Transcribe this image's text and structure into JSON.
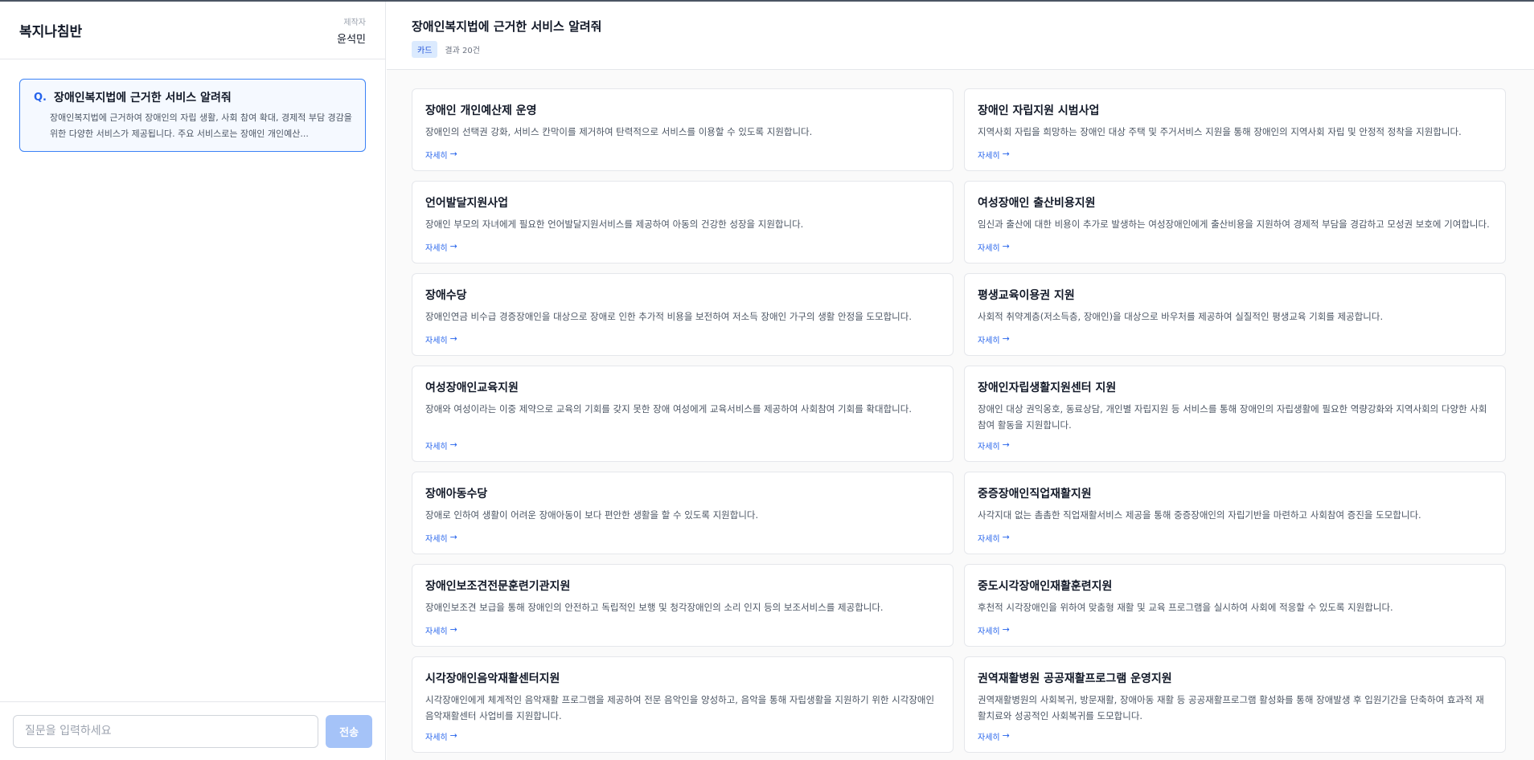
{
  "sidebar": {
    "app_title": "복지나침반",
    "maker_label": "제작자",
    "maker_name": "윤석민",
    "question": {
      "mark": "Q.",
      "title": "장애인복지법에 근거한 서비스 알려줘",
      "answer": "장애인복지법에 근거하여 장애인의 자립 생활, 사회 참여 확대, 경제적 부담 경감을 위한 다양한 서비스가 제공됩니다. 주요 서비스로는 장애인 개인예산..."
    },
    "input_placeholder": "질문을 입력하세요",
    "send_label": "전송"
  },
  "main": {
    "title": "장애인복지법에 근거한 서비스 알려줘",
    "view_badge": "카드",
    "result_count": "결과 20건",
    "link_label": "자세히",
    "link_arrow": "→",
    "cards": [
      {
        "title": "장애인 개인예산제 운영",
        "desc": "장애인의 선택권 강화, 서비스 칸막이를 제거하여 탄력적으로 서비스를 이용할 수 있도록 지원합니다."
      },
      {
        "title": "장애인 자립지원 시범사업",
        "desc": "지역사회 자립을 희망하는 장애인 대상 주택 및 주거서비스 지원을 통해 장애인의 지역사회 자립 및 안정적 정착을 지원합니다."
      },
      {
        "title": "언어발달지원사업",
        "desc": "장애인 부모의 자녀에게 필요한 언어발달지원서비스를 제공하여 아동의 건강한 성장을 지원합니다."
      },
      {
        "title": "여성장애인 출산비용지원",
        "desc": "임신과 출산에 대한 비용이 추가로 발생하는 여성장애인에게 출산비용을 지원하여 경제적 부담을 경감하고 모성권 보호에 기여합니다."
      },
      {
        "title": "장애수당",
        "desc": "장애인연금 비수급 경증장애인을 대상으로 장애로 인한 추가적 비용을 보전하여 저소득 장애인 가구의 생활 안정을 도모합니다."
      },
      {
        "title": "평생교육이용권 지원",
        "desc": "사회적 취약계층(저소득층, 장애인)을 대상으로 바우처를 제공하여 실질적인 평생교육 기회를 제공합니다."
      },
      {
        "title": "여성장애인교육지원",
        "desc": "장애와 여성이라는 이중 제약으로 교육의 기회를 갖지 못한 장애 여성에게 교육서비스를 제공하여 사회참여 기회를 확대합니다."
      },
      {
        "title": "장애인자립생활지원센터 지원",
        "desc": "장애인 대상 권익옹호, 동료상담, 개인별 자립지원 등 서비스를 통해 장애인의 자립생활에 필요한 역량강화와 지역사회의 다양한 사회참여 활동을 지원합니다."
      },
      {
        "title": "장애아동수당",
        "desc": "장애로 인하여 생활이 어려운 장애아동이 보다 편안한 생활을 할 수 있도록 지원합니다."
      },
      {
        "title": "중증장애인직업재활지원",
        "desc": "사각지대 없는 촘촘한 직업재활서비스 제공을 통해 중증장애인의 자립기반을 마련하고 사회참여 증진을 도모합니다."
      },
      {
        "title": "장애인보조견전문훈련기관지원",
        "desc": "장애인보조견 보급을 통해 장애인의 안전하고 독립적인 보행 및 청각장애인의 소리 인지 등의 보조서비스를 제공합니다."
      },
      {
        "title": "중도시각장애인재활훈련지원",
        "desc": "후천적 시각장애인을 위하여 맞춤형 재활 및 교육 프로그램을 실시하여 사회에 적응할 수 있도록 지원합니다."
      },
      {
        "title": "시각장애인음악재활센터지원",
        "desc": "시각장애인에게 체계적인 음악재활 프로그램을 제공하여 전문 음악인을 양성하고, 음악을 통해 자립생활을 지원하기 위한 시각장애인음악재활센터 사업비를 지원합니다."
      },
      {
        "title": "권역재활병원 공공재활프로그램 운영지원",
        "desc": "권역재활병원의 사회복귀, 방문재활, 장애아동 재활 등 공공재활프로그램 활성화를 통해 장애발생 후 입원기간을 단축하여 효과적 재활치료와 성공적인 사회복귀를 도모합니다."
      }
    ]
  }
}
